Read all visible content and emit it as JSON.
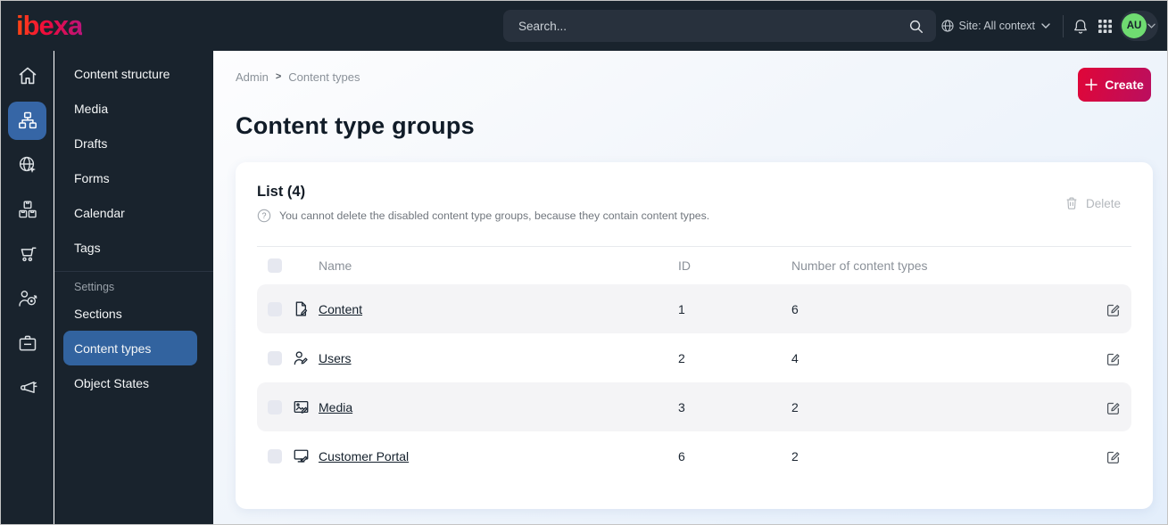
{
  "brand": {
    "logo_text": "ibexa",
    "logo_gradient": [
      "#ff4713",
      "#bb147b"
    ]
  },
  "topbar": {
    "search_placeholder": "Search...",
    "site_context_label": "Site: All context"
  },
  "user": {
    "initials": "AU",
    "avatar_color": "#6fdb71"
  },
  "rail": {
    "items": [
      {
        "icon": "home-icon",
        "active": false
      },
      {
        "icon": "content-structure-icon",
        "active": true
      },
      {
        "icon": "site-globe-icon",
        "active": false
      },
      {
        "icon": "commerce-boxes-icon",
        "active": false
      },
      {
        "icon": "cart-icon",
        "active": false
      },
      {
        "icon": "personalization-target-icon",
        "active": false
      },
      {
        "icon": "admin-badge-icon",
        "active": false
      },
      {
        "icon": "promotions-megaphone-icon",
        "active": false
      }
    ]
  },
  "sidebar": {
    "items": [
      "Content structure",
      "Media",
      "Drafts",
      "Forms",
      "Calendar",
      "Tags"
    ],
    "section_label": "Settings",
    "settings_items": [
      "Sections",
      "Content types",
      "Object States"
    ],
    "active_item": "Content types",
    "active_color": "#32639f"
  },
  "breadcrumb": {
    "items": [
      "Admin",
      "Content types"
    ],
    "separator": ">"
  },
  "page": {
    "title": "Content type groups"
  },
  "actions": {
    "create_label": "Create",
    "delete_label": "Delete"
  },
  "list": {
    "title": "List (4)",
    "help_text": "You cannot delete the disabled content type groups, because they contain content types.",
    "columns": [
      "Name",
      "ID",
      "Number of content types"
    ],
    "rows": [
      {
        "icon": "file-icon",
        "name": "Content",
        "id": "1",
        "count": "6"
      },
      {
        "icon": "user-icon",
        "name": "Users",
        "id": "2",
        "count": "4"
      },
      {
        "icon": "image-icon",
        "name": "Media",
        "id": "3",
        "count": "2"
      },
      {
        "icon": "desktop-icon",
        "name": "Customer Portal",
        "id": "6",
        "count": "2"
      }
    ]
  },
  "colors": {
    "accent_gradient": [
      "#e00638",
      "#ba0f5f"
    ],
    "topbar_bg": "#19232d",
    "stripe": "#f4f4f6"
  }
}
